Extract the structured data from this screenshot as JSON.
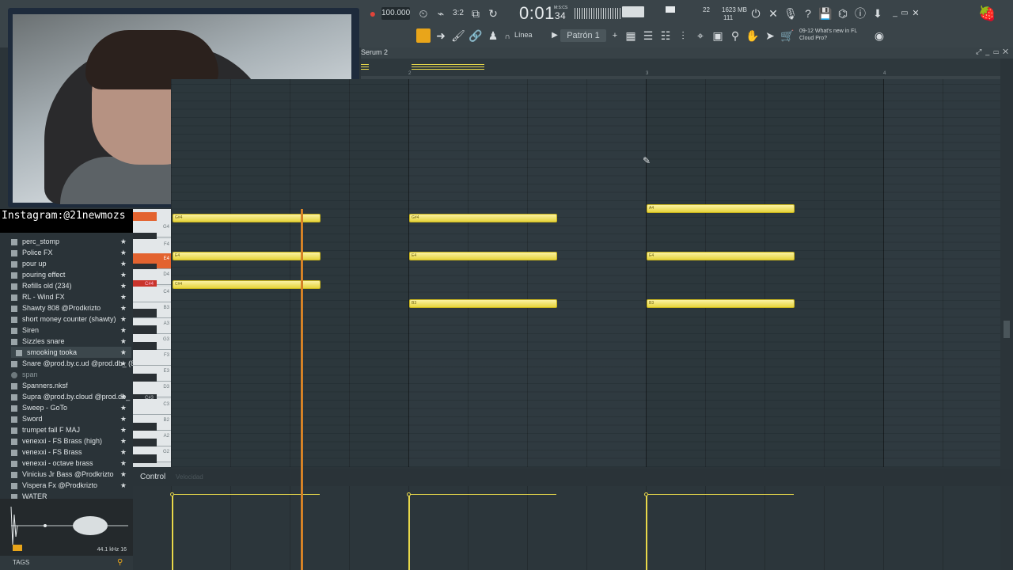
{
  "toolbar": {
    "tempo": "100.000",
    "time_main": "0:01",
    "time_sub": "34",
    "time_label": "M:S:CS",
    "cpu_a": "22",
    "cpu_b": "1623 MB",
    "cpu_c": "111",
    "linea_label": "Línea",
    "pattern": "Patrón 1",
    "news_title": "09-12  What's new in FL Cloud Pro?"
  },
  "webcam": {
    "overlay_handle": "Instagram:@21newmozs"
  },
  "browser": {
    "items": [
      {
        "label": "perc_stomp"
      },
      {
        "label": "Police FX"
      },
      {
        "label": "pour up"
      },
      {
        "label": "pouring effect"
      },
      {
        "label": "Refills old (234)"
      },
      {
        "label": "RL - Wind FX"
      },
      {
        "label": "Shawty 808 @Prodkrizto"
      },
      {
        "label": "short money counter (shawty)"
      },
      {
        "label": "Siren"
      },
      {
        "label": "Sizzles snare"
      },
      {
        "label": "smooking tooka"
      },
      {
        "label": "Snare @prod.by.c.ud @prod.db_ (8)"
      },
      {
        "label": "span"
      },
      {
        "label": "Spanners.nksf"
      },
      {
        "label": "Supra @prod.by.cloud @prod.db_"
      },
      {
        "label": "Sweep - GoTo"
      },
      {
        "label": "Sword"
      },
      {
        "label": "trumpet fall F MAJ"
      },
      {
        "label": "venexxi - FS Brass (high)"
      },
      {
        "label": "venexxi - FS Brass"
      },
      {
        "label": "venexxi - octave brass"
      },
      {
        "label": "Vinicius Jr Bass @Prodkrizto"
      },
      {
        "label": "Vispera Fx @Prodkrizto"
      },
      {
        "label": "WATER"
      }
    ],
    "sample_rate": "44.1 kHz 16",
    "tags_label": "TAGS"
  },
  "piano_roll": {
    "title": "Serum 2",
    "ruler": [
      "2",
      "3",
      "4"
    ],
    "keys": [
      "G4",
      "F4",
      "E4",
      "D4",
      "C4",
      "B3",
      "A3",
      "G3",
      "F3",
      "E3",
      "D3",
      "C3",
      "B2",
      "A2",
      "G2"
    ],
    "key_c3_tag": "C#3",
    "key_c4_tag": "C#4",
    "notes": [
      {
        "label": "G#4"
      },
      {
        "label": "E4"
      },
      {
        "label": "C#4"
      },
      {
        "label": "G#4"
      },
      {
        "label": "E4"
      },
      {
        "label": "B3"
      },
      {
        "label": "A4"
      },
      {
        "label": "E4"
      },
      {
        "label": "B3"
      }
    ],
    "control_label": "Control",
    "control_param": "Velocidad"
  }
}
